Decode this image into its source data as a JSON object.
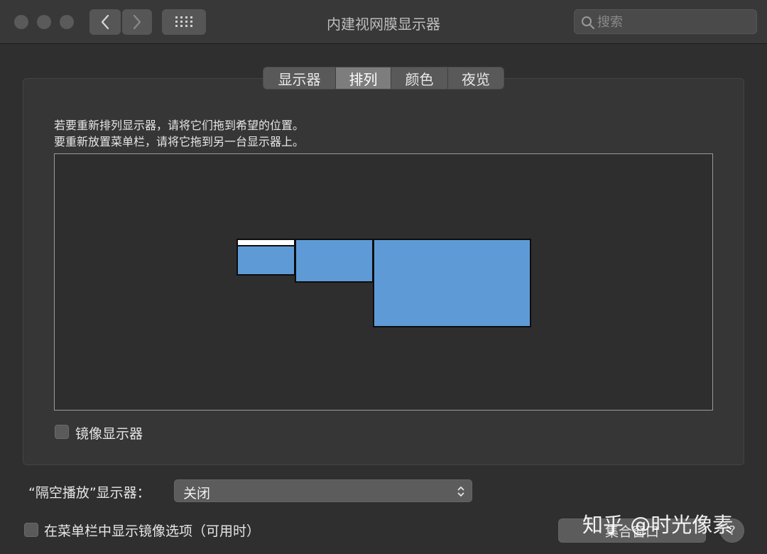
{
  "window": {
    "title": "内建视网膜显示器",
    "search_placeholder": "搜索"
  },
  "tabs": [
    {
      "label": "显示器",
      "selected": false
    },
    {
      "label": "排列",
      "selected": true
    },
    {
      "label": "颜色",
      "selected": false
    },
    {
      "label": "夜览",
      "selected": false
    }
  ],
  "arrangement": {
    "instruction_line1": "若要重新排列显示器，请将它们拖到希望的位置。",
    "instruction_line2": "要重新放置菜单栏，请将它拖到另一台显示器上。",
    "display_color": "#5e9bd6",
    "displays": 3
  },
  "mirror_checkbox": {
    "label": "镜像显示器",
    "checked": false
  },
  "airplay": {
    "label": "“隔空播放”显示器：",
    "value": "关闭"
  },
  "menubar_checkbox": {
    "label": "在菜单栏中显示镜像选项（可用时）",
    "checked": false
  },
  "gather_button": {
    "label": "集合窗口"
  },
  "help_button": {
    "label": "?"
  },
  "watermark": {
    "text": "知乎 @时光像素"
  }
}
